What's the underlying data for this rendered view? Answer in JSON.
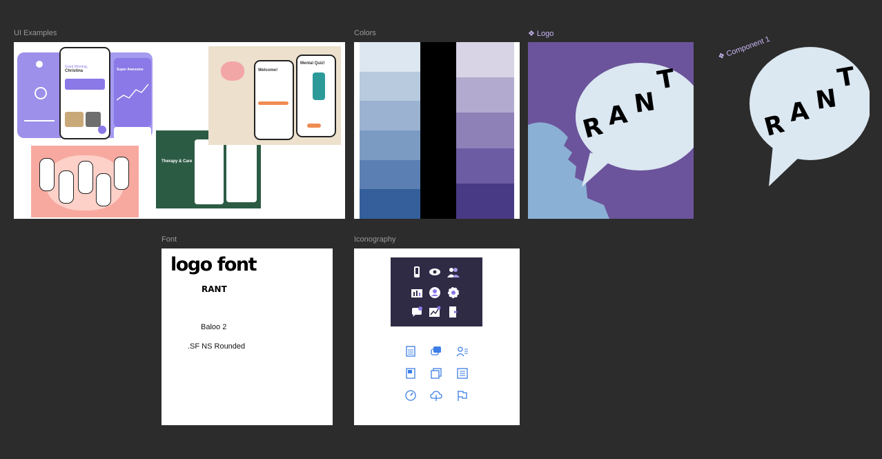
{
  "frames": {
    "ui_examples": {
      "label": "UI Examples"
    },
    "colors": {
      "label": "Colors"
    },
    "logo": {
      "label": "❖ Logo",
      "word": "RANT"
    },
    "component": {
      "label": "❖ Component 1",
      "word": "RANT"
    },
    "font": {
      "label": "Font",
      "title": "logo font",
      "sample": "RANT",
      "fonts": [
        "Baloo 2",
        ".SF NS Rounded"
      ]
    },
    "iconography": {
      "label": "Iconography"
    }
  },
  "palettes": {
    "blue": [
      "#dce7f1",
      "#b7cade",
      "#9bb3d1",
      "#7b9bc3",
      "#5b7fb2",
      "#345f9a"
    ],
    "black": [
      "#000000"
    ],
    "purple": [
      "#d8d4e5",
      "#b3abcf",
      "#8e81b8",
      "#6b5ca3",
      "#493a86"
    ]
  },
  "mockups": {
    "card1": {
      "greeting": "Good Morning,",
      "name": "Christina",
      "title": "Super Awesome"
    },
    "card_green": {
      "title": "Therapy & Care"
    },
    "card_quiz": {
      "title": "Mental Quiz!",
      "welcome": "Welcome!"
    }
  },
  "colors": {
    "accent": "#8a79e6",
    "logo_bg": "#6b549b",
    "bubble": "#dbe7f1",
    "icon_blue": "#3c7de6"
  },
  "icons": {
    "dark_panel": [
      "phone-icon",
      "eye-icon",
      "users-icon",
      "chart-icon",
      "user-circle-icon",
      "gear-icon",
      "chat-icon",
      "analytics-icon",
      "door-icon"
    ],
    "blue_panel": [
      "notepad-icon",
      "messages-icon",
      "user-list-icon",
      "journal-icon",
      "copy-icon",
      "list-icon",
      "gauge-icon",
      "cloud-upload-icon",
      "flag-icon"
    ]
  }
}
